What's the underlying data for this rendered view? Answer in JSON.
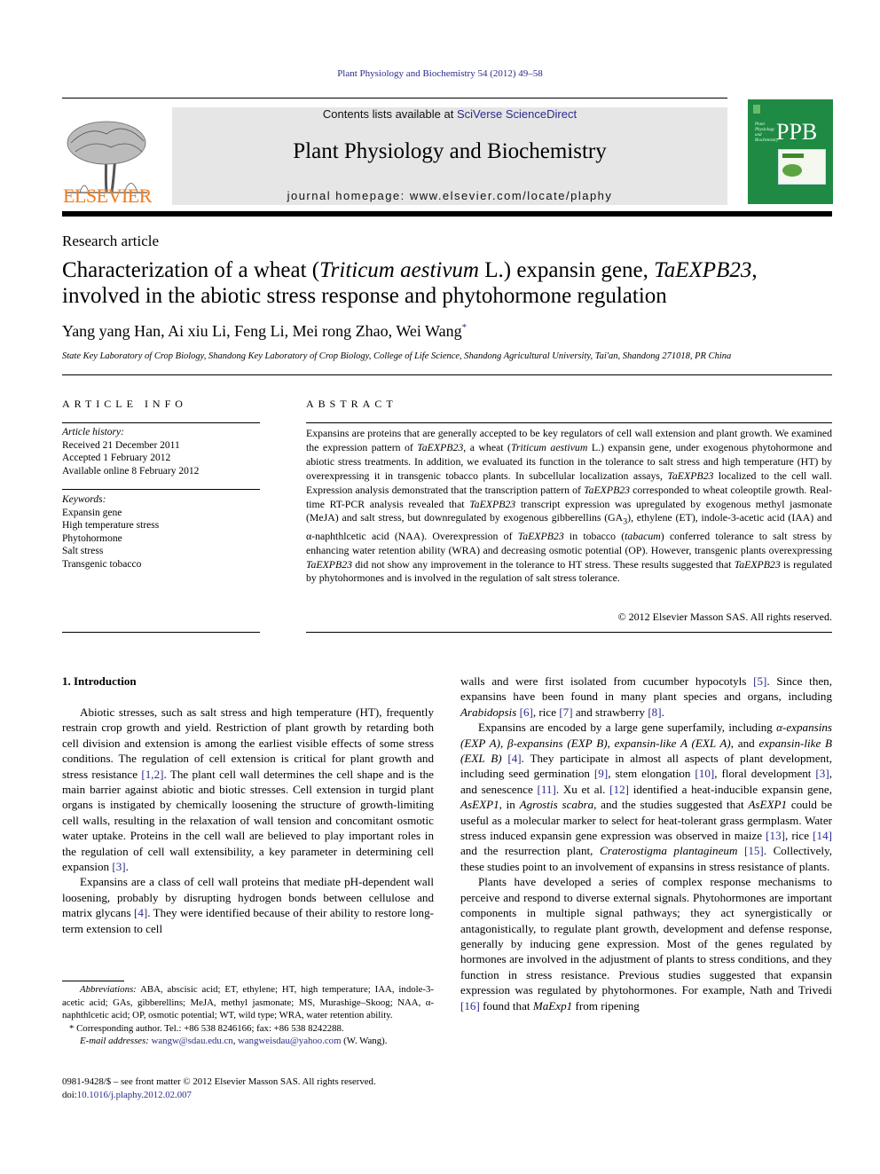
{
  "running_header": "Plant Physiology and Biochemistry 54 (2012) 49–58",
  "masthead": {
    "publisher_logo": "tree-logo",
    "publisher": "ELSEVIER",
    "contents_prefix": "Contents lists available at ",
    "contents_link": "SciVerse ScienceDirect",
    "journal_title": "Plant Physiology and Biochemistry",
    "homepage": "journal homepage: www.elsevier.com/locate/plaphy",
    "cover_abbrev": "PPB",
    "cover_subtitle": [
      "Plant",
      "Physiology",
      "and",
      "Biochemistry"
    ]
  },
  "colors": {
    "link": "#2b2b8c",
    "elsevier_orange": "#f07b1a",
    "cover_green": "#1e8a43",
    "masthead_bg": "#e6e6e6"
  },
  "article": {
    "type": "Research article",
    "title_parts": {
      "p1": "Characterization of a wheat (",
      "p2_italic": "Triticum aestivum",
      "p3": " L.) expansin gene, ",
      "p4_italic": "TaEXPB23",
      "p5": ",",
      "line2": "involved in the abiotic stress response and phytohormone regulation"
    },
    "authors": "Yang yang Han, Ai xiu Li, Feng Li, Mei rong Zhao, Wei Wang",
    "corresponding_mark": "*",
    "affiliation": "State Key Laboratory of Crop Biology, Shandong Key Laboratory of Crop Biology, College of Life Science, Shandong Agricultural University, Tai'an, Shandong 271018, PR China"
  },
  "article_info": {
    "heading": "ARTICLE INFO",
    "history_label": "Article history:",
    "history": [
      "Received 21 December 2011",
      "Accepted 1 February 2012",
      "Available online 8 February 2012"
    ],
    "keywords_label": "Keywords:",
    "keywords": [
      "Expansin gene",
      "High temperature stress",
      "Phytohormone",
      "Salt stress",
      "Transgenic tobacco"
    ]
  },
  "abstract": {
    "heading": "ABSTRACT",
    "s1": "Expansins are proteins that are generally accepted to be key regulators of cell wall extension and plant growth. We examined the expression pattern of ",
    "g1": "TaEXPB23",
    "s2": ", a wheat (",
    "sp": "Triticum aestivum",
    "s3": " L.) expansin gene, under exogenous phytohormone and abiotic stress treatments. In addition, we evaluated its function in the tolerance to salt stress and high temperature (HT) by overexpressing it in transgenic tobacco plants. In subcellular localization assays, ",
    "g2": "TaEXPB23",
    "s4": " localized to the cell wall. Expression analysis demonstrated that the transcription pattern of ",
    "g3": "TaEXPB23",
    "s5": " corresponded to wheat coleoptile growth. Real-time RT-PCR analysis revealed that ",
    "g4": "TaEXPB23",
    "s6": " transcript expression was upregulated by exogenous methyl jasmonate (MeJA) and salt stress, but downregulated by exogenous gibberellins (GA",
    "sub3": "3",
    "s7": "), ethylene (ET), indole-3-acetic acid (IAA) and α-naphthlcetic acid (NAA). Overexpression of ",
    "g5": "TaEXPB23",
    "s8": " in tobacco (",
    "tab": "tabacum",
    "s9": ") conferred tolerance to salt stress by enhancing water retention ability (WRA) and decreasing osmotic potential (OP). However, transgenic plants overexpressing ",
    "g6": "TaEXPB23",
    "s10": " did not show any improvement in the tolerance to HT stress. These results suggested that ",
    "g7": "TaEXPB23",
    "s11": " is regulated by phytohormones and is involved in the regulation of salt stress tolerance.",
    "copyright": "© 2012 Elsevier Masson SAS. All rights reserved."
  },
  "introduction": {
    "heading": "1.  Introduction",
    "left_p1_a": "Abiotic stresses, such as salt stress and high temperature (HT), frequently restrain crop growth and yield. Restriction of plant growth by retarding both cell division and extension is among the earliest visible effects of some stress conditions. The regulation of cell extension is critical for plant growth and stress resistance ",
    "ref_1_2": "[1,2]",
    "left_p1_b": ". The plant cell wall determines the cell shape and is the main barrier against abiotic and biotic stresses. Cell extension in turgid plant organs is instigated by chemically loosening the structure of growth-limiting cell walls, resulting in the relaxation of wall tension and concomitant osmotic water uptake. Proteins in the cell wall are believed to play important roles in the regulation of cell wall extensibility, a key parameter in determining cell expansion ",
    "ref_3": "[3]",
    "left_p1_c": ".",
    "left_p2_a": "Expansins are a class of cell wall proteins that mediate pH-dependent wall loosening, probably by disrupting hydrogen bonds between cellulose and matrix glycans ",
    "ref_4": "[4]",
    "left_p2_b": ". They were identified because of their ability to restore long-term extension to cell",
    "right_p0_a": "walls and were first isolated from cucumber hypocotyls ",
    "ref_5": "[5]",
    "right_p0_b": ". Since then, expansins have been found in many plant species and organs, including ",
    "arabidopsis": "Arabidopsis",
    "ref_6": "[6]",
    "right_p0_c": ", rice ",
    "ref_7": "[7]",
    "right_p0_d": " and strawberry ",
    "ref_8": "[8]",
    "right_p0_e": ".",
    "right_p1_a": "Expansins are encoded by a large gene superfamily, including ",
    "exp_a": "α-expansins (EXP A)",
    "comma1": ", ",
    "exp_b": "β-expansins (EXP B)",
    "comma2": ", ",
    "exl_a": "expansin-like A (EXL A)",
    "and1": ", and ",
    "exl_b": "expansin-like B (EXL B)",
    "sp1": " ",
    "ref_4b": "[4]",
    "right_p1_b": ". They participate in almost all aspects of plant development, including seed germination ",
    "ref_9": "[9]",
    "right_p1_c": ", stem elongation ",
    "ref_10": "[10]",
    "right_p1_d": ", floral development ",
    "ref_3b": "[3]",
    "right_p1_e": ", and senescence ",
    "ref_11": "[11]",
    "right_p1_f": ". Xu et al. ",
    "ref_12": "[12]",
    "right_p1_g": " identified a heat-inducible expansin gene, ",
    "asexp1": "AsEXP1",
    "right_p1_h": ", in ",
    "agrostis": "Agrostis scabra",
    "right_p1_i": ", and the studies suggested that ",
    "asexp1b": "AsEXP1",
    "right_p1_j": " could be useful as a molecular marker to select for heat-tolerant grass germplasm. Water stress induced expansin gene expression was observed in maize ",
    "ref_13": "[13]",
    "right_p1_k": ", rice ",
    "ref_14": "[14]",
    "right_p1_l": " and the resurrection plant, ",
    "crater": "Craterostigma plantagineum",
    "sp2": " ",
    "ref_15": "[15]",
    "right_p1_m": ". Collectively, these studies point to an involvement of expansins in stress resistance of plants.",
    "right_p2_a": "Plants have developed a series of complex response mechanisms to perceive and respond to diverse external signals. Phytohormones are important components in multiple signal pathways; they act synergistically or antagonistically, to regulate plant growth, development and defense response, generally by inducing gene expression. Most of the genes regulated by hormones are involved in the adjustment of plants to stress conditions, and they function in stress resistance. Previous studies suggested that expansin expression was regulated by phytohormones. For example, Nath and Trivedi ",
    "ref_16": "[16]",
    "right_p2_b": " found that ",
    "maexp1": "MaExp1",
    "right_p2_c": " from ripening"
  },
  "footnotes": {
    "abbrev_label": "Abbreviations:",
    "abbrev_text": " ABA, abscisic acid; ET, ethylene; HT, high temperature; IAA, indole-3-acetic acid; GAs, gibberellins; MeJA, methyl jasmonate; MS, Murashige–Skoog; NAA, α-naphthlcetic acid; OP, osmotic potential; WT, wild type; WRA, water retention ability.",
    "corresponding": "* Corresponding author. Tel.: +86 538 8246166; fax: +86 538 8242288.",
    "email_label": "E-mail addresses:",
    "email1": "wangw@sdau.edu.cn",
    "email_sep": ", ",
    "email2": "wangweisdau@yahoo.com",
    "email_suffix": " (W. Wang).",
    "issn": "0981-9428/$ – see front matter © 2012 Elsevier Masson SAS. All rights reserved.",
    "doi_label": "doi:",
    "doi": "10.1016/j.plaphy.2012.02.007"
  }
}
